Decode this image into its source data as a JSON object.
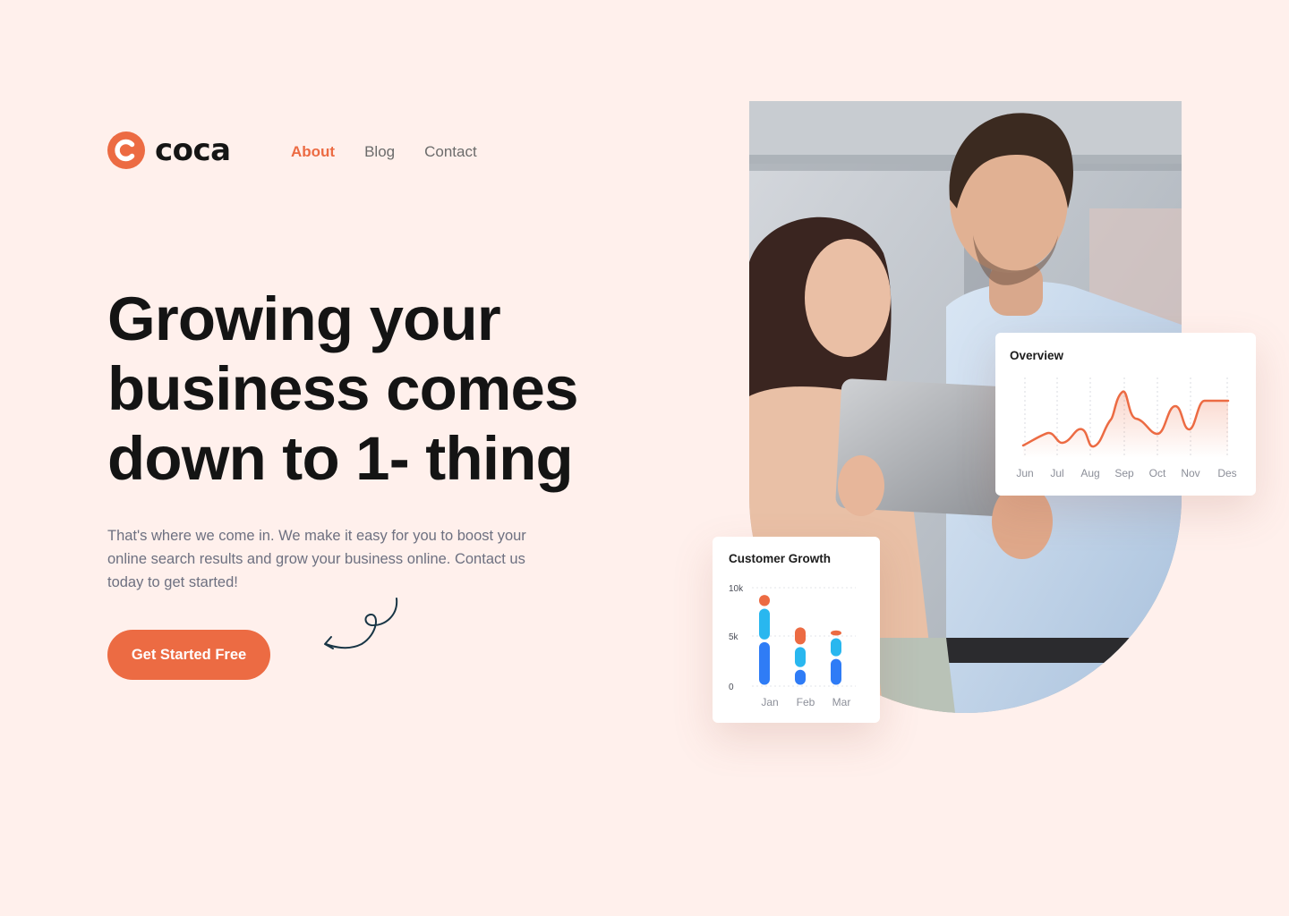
{
  "brand": {
    "name": "coca",
    "accent": "#ec6b43"
  },
  "nav": {
    "items": [
      {
        "label": "About",
        "active": true
      },
      {
        "label": "Blog",
        "active": false
      },
      {
        "label": "Contact",
        "active": false
      }
    ]
  },
  "hero": {
    "headline": "Growing your business comes down to 1- thing",
    "subtext": "That's where we come in. We make it easy for you to boost your online search results and grow your business online. Contact us today to get started!",
    "cta_label": "Get Started Free",
    "decor": "curly-arrow-icon",
    "image": "photo of two colleagues smiling at a tablet"
  },
  "overview_card": {
    "title": "Overview",
    "chart_data": {
      "type": "line",
      "categories": [
        "Jun",
        "Jul",
        "Aug",
        "Sep",
        "Oct",
        "Nov",
        "Des"
      ],
      "color": "#ec6b43",
      "grid": "vertical dashed",
      "fill": "gradient"
    }
  },
  "growth_card": {
    "title": "Customer Growth",
    "chart_data": {
      "type": "bar",
      "stacked": true,
      "categories": [
        "Jan",
        "Feb",
        "Mar"
      ],
      "y_ticks": [
        "10k",
        "5k",
        "0"
      ],
      "ylim": [
        0,
        10000
      ],
      "series": [
        {
          "color": "#2f7cf6",
          "values": [
            4600,
            1800,
            2900
          ]
        },
        {
          "color": "#29b7ef",
          "values": [
            3400,
            2300,
            2100
          ]
        },
        {
          "color": "#ec6b43",
          "values": [
            1400,
            2000,
            800
          ]
        }
      ]
    }
  }
}
